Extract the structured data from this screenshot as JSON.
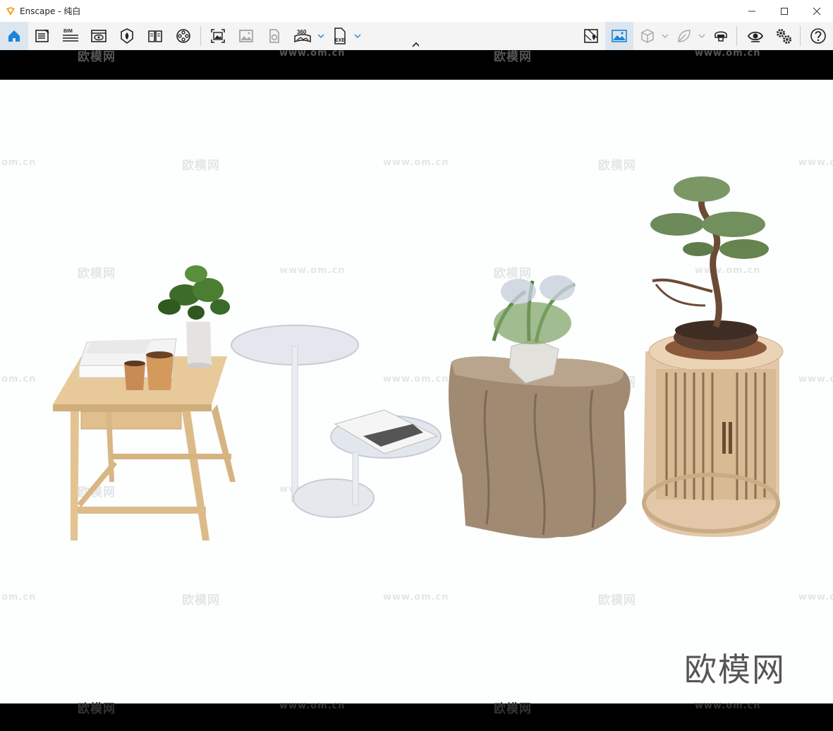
{
  "window": {
    "title": "Enscape - 纯白",
    "controls": [
      "minimize",
      "maximize",
      "close"
    ]
  },
  "toolbar": {
    "bim_label": "BIM",
    "pano_label": "360",
    "exe_label": "EXE",
    "accent_color": "#1a84d8"
  },
  "watermarks": {
    "brand": "欧模网",
    "url": "www.om.cn",
    "url_partial_left": "om.cn",
    "url_partial_right": "www.o"
  },
  "colors": {
    "toolbar_bg": "#f4f4f4",
    "viewport_bg": "#fdfefe"
  }
}
